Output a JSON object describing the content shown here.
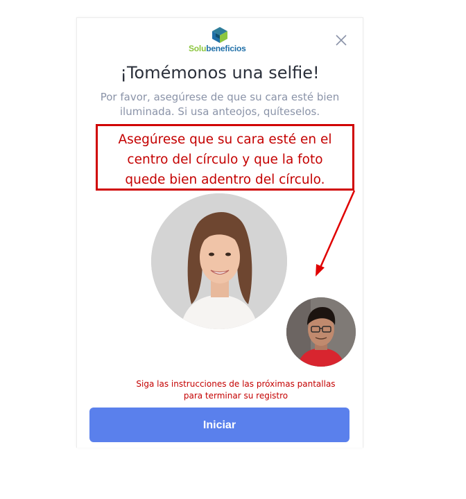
{
  "brand": {
    "name_part1": "Solu",
    "name_part2": "beneficios"
  },
  "modal": {
    "title": "¡Tomémonos una selfie!",
    "subtitle_line1": "Por favor, asegúrese de que su cara esté bien",
    "subtitle_line2": "iluminada. Si usa anteojos, quíteselos."
  },
  "callout": {
    "line1": "Asegúrese que su cara esté en el",
    "line2": "centro del círculo y que la foto",
    "line3": "quede bien adentro del círculo."
  },
  "hint": {
    "line1": "Siga las instrucciones de las próximas pantallas",
    "line2": "para terminar su registro"
  },
  "actions": {
    "start_label": "Iniciar"
  },
  "icons": {
    "close": "close-icon",
    "logo": "solubeneficios-logo-icon"
  },
  "colors": {
    "accent_button": "#5a80ec",
    "annotation_red": "#c40000",
    "brand_green": "#8cc63f",
    "brand_blue": "#1f6fa8"
  }
}
